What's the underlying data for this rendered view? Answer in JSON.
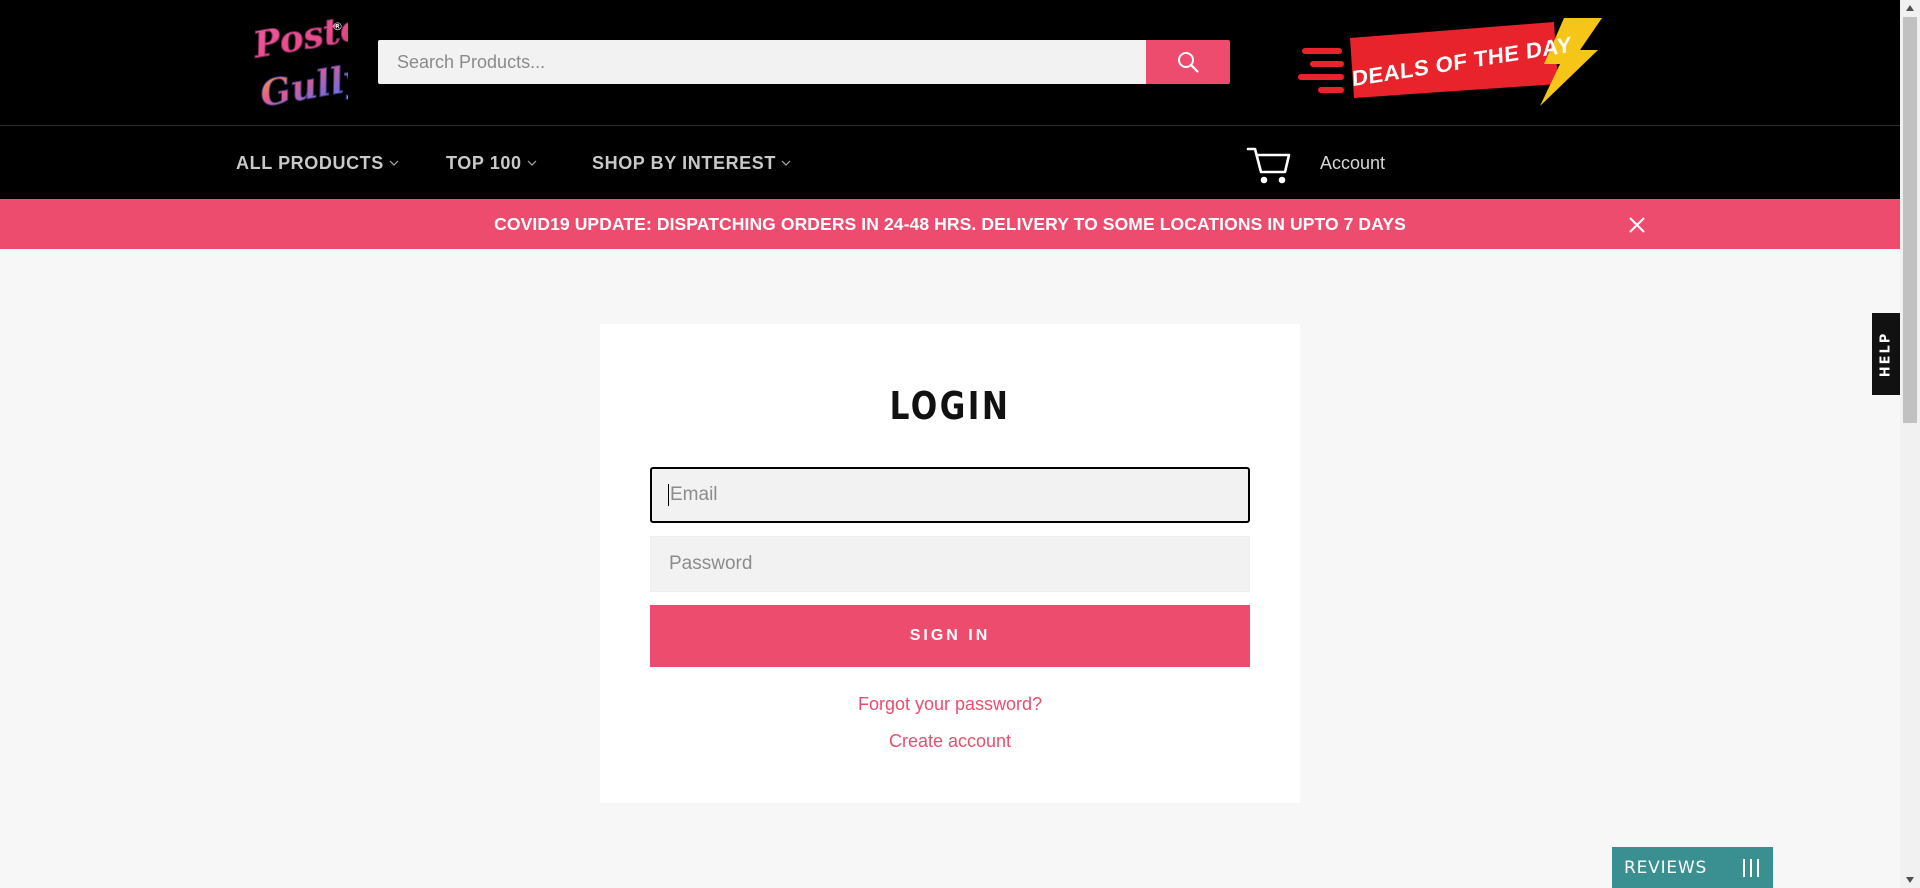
{
  "header": {
    "logo": {
      "text_line1": "Poster",
      "text_line2": "Gully",
      "registered": "®"
    },
    "search": {
      "placeholder": "Search Products...",
      "value": "",
      "button_icon": "search-icon"
    },
    "deals_banner": {
      "label": "DEALS OF THE DAY",
      "colors": {
        "ribbon": "#e8232b",
        "bolt": "#f5c518"
      }
    },
    "nav": {
      "items": [
        {
          "label": "ALL PRODUCTS",
          "icon": "chevron-down-icon"
        },
        {
          "label": "TOP 100",
          "icon": "chevron-down-icon"
        },
        {
          "label": "SHOP BY INTEREST",
          "icon": "chevron-down-icon"
        }
      ],
      "cart_icon": "cart-icon",
      "account_label": "Account"
    }
  },
  "announcement": {
    "text": "COVID19 UPDATE: DISPATCHING ORDERS IN 24-48 HRS. DELIVERY TO SOME LOCATIONS IN UPTO 7 DAYS",
    "close_icon": "close-icon"
  },
  "login": {
    "title": "LOGIN",
    "email": {
      "placeholder": "Email",
      "value": ""
    },
    "password": {
      "placeholder": "Password",
      "value": ""
    },
    "submit_label": "SIGN IN",
    "forgot_label": "Forgot your password?",
    "create_label": "Create account"
  },
  "widgets": {
    "help_label": "HELP",
    "reviews_label": "REVIEWS",
    "reviews_icon": "bars-icon"
  },
  "colors": {
    "accent": "#ee4c6e",
    "header_bg": "#000000",
    "page_bg": "#f7f7f7",
    "reviews_bg": "#3a8f90"
  }
}
